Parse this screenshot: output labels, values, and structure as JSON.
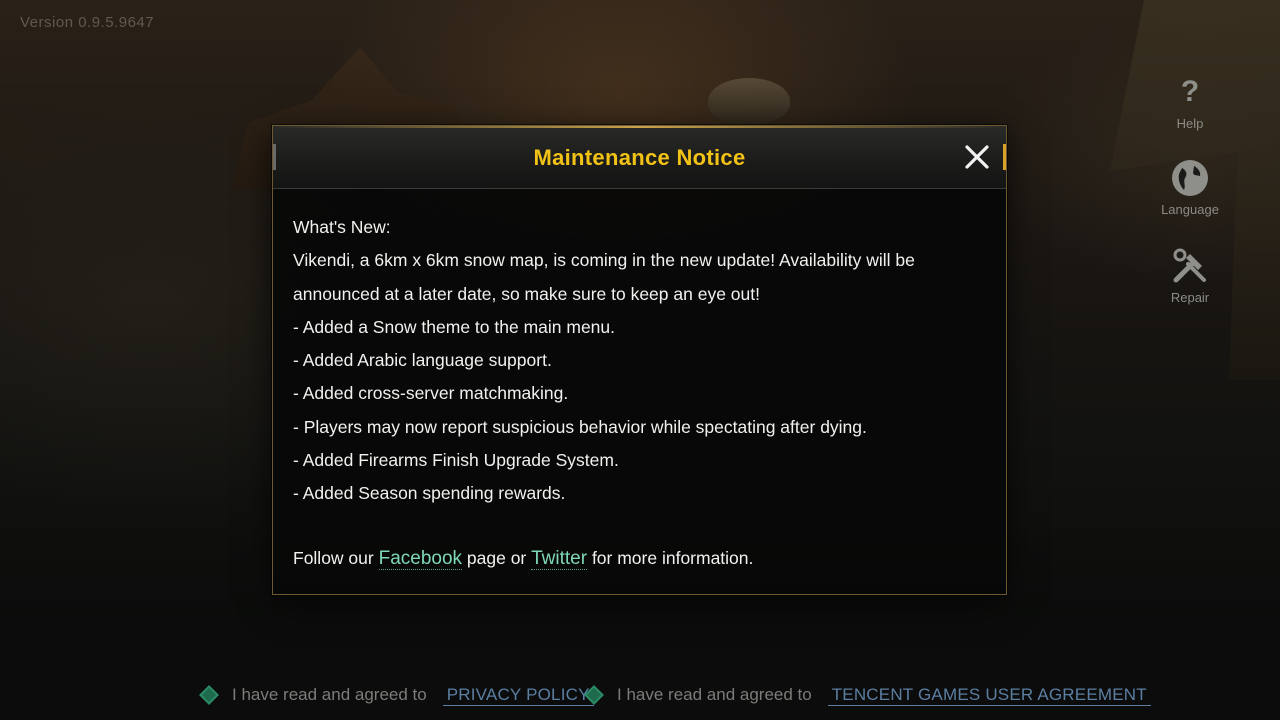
{
  "app": {
    "version": "Version 0.9.5.9647"
  },
  "side_buttons": [
    {
      "label": "Help",
      "icon": "question-icon"
    },
    {
      "label": "Language",
      "icon": "globe-icon"
    },
    {
      "label": "Repair",
      "icon": "tools-icon"
    }
  ],
  "modal": {
    "title": "Maintenance Notice",
    "close_icon": "close-icon",
    "heading": "What's New:",
    "lines": [
      "Vikendi, a 6km x 6km snow map, is coming in the new update! Availability will be announced at a later date, so make sure to keep an eye out!",
      "- Added a Snow theme to the main menu.",
      "- Added Arabic language support.",
      "- Added cross-server matchmaking.",
      "- Players may now report suspicious behavior while spectating after dying.",
      "- Added Firearms Finish Upgrade System.",
      "- Added Season spending rewards."
    ],
    "footer": {
      "prefix": "Follow our ",
      "link1": "Facebook",
      "middle": " page or ",
      "link2": "Twitter",
      "suffix": " for more information."
    }
  },
  "agreements": [
    {
      "text": "I have read and agreed to",
      "link": "PRIVACY POLICY"
    },
    {
      "text": "I have read and agreed to",
      "link": "TENCENT GAMES USER AGREEMENT"
    }
  ],
  "colors": {
    "title": "#f2c316",
    "link": "#7fd8b6",
    "agreement_link": "#5b7fa3",
    "checkbox": "#2a8b64"
  }
}
